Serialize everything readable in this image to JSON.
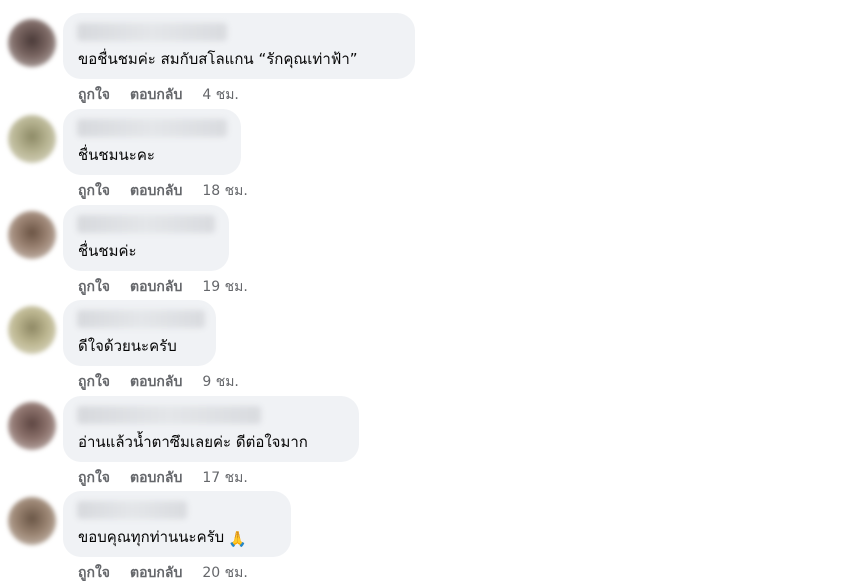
{
  "comments": [
    {
      "text": "ขอชื่นชมค่ะ สมกับสโลแกน “รักคุณเท่าฟ้า”",
      "like": "ถูกใจ",
      "reply": "ตอบกลับ",
      "time": "4 ชม.",
      "avatar_color": "#6e5a55"
    },
    {
      "text": "ชื่นชมนะคะ",
      "like": "ถูกใจ",
      "reply": "ตอบกลับ",
      "time": "18 ชม.",
      "avatar_color": "#9c9a78"
    },
    {
      "text": "ชื่นชมค่ะ",
      "like": "ถูกใจ",
      "reply": "ตอบกลับ",
      "time": "19 ชม.",
      "avatar_color": "#8a6e5c"
    },
    {
      "text": "ดีใจด้วยนะครับ",
      "like": "ถูกใจ",
      "reply": "ตอบกลับ",
      "time": "9 ชม.",
      "avatar_color": "#a6a07a"
    },
    {
      "text": "อ่านแล้วน้ำตาซึมเลยค่ะ ดีต่อใจมาก",
      "like": "ถูกใจ",
      "reply": "ตอบกลับ",
      "time": "17 ชม.",
      "avatar_color": "#7a5f58"
    },
    {
      "text": "ขอบคุณทุกท่านนะครับ",
      "emoji": "🙏",
      "like": "ถูกใจ",
      "reply": "ตอบกลับ",
      "time": "20 ชม.",
      "avatar_color": "#8c7462"
    }
  ]
}
